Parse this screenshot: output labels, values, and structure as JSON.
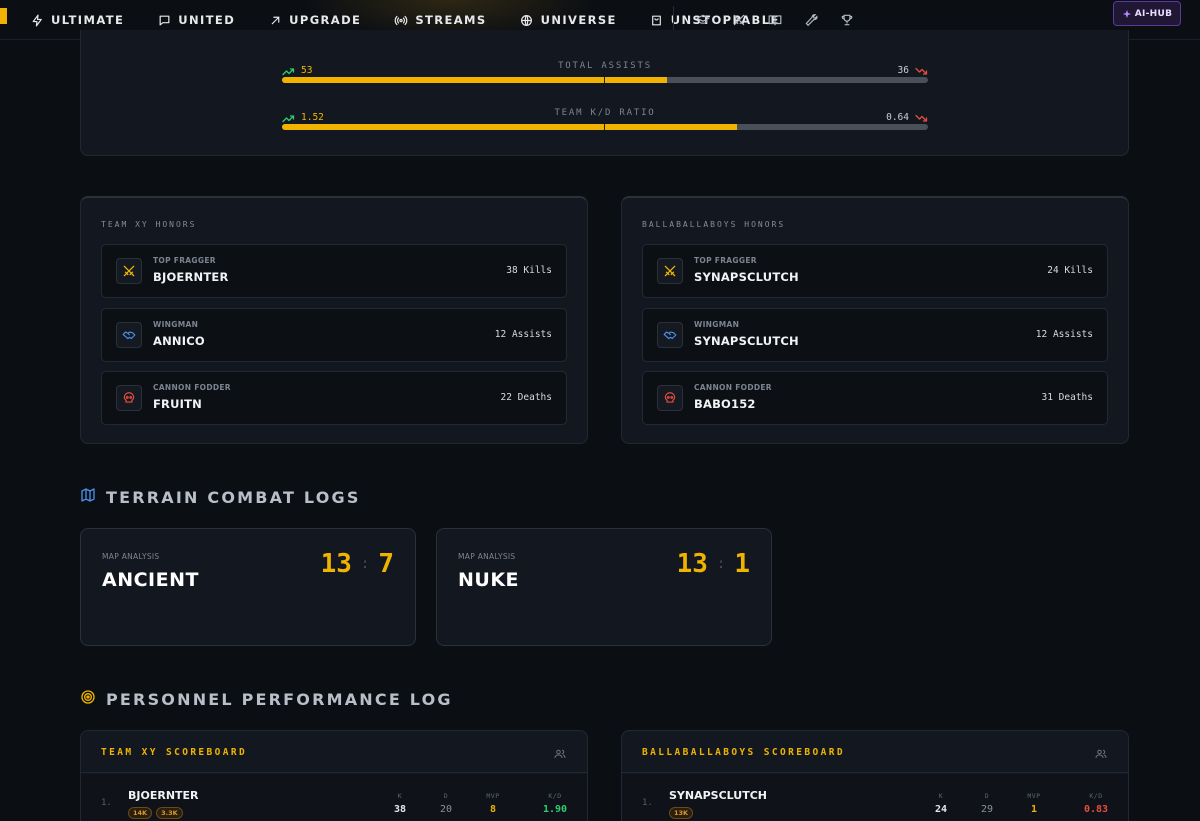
{
  "nav": {
    "items": [
      {
        "label": "ULTIMATE",
        "icon": "bolt-icon"
      },
      {
        "label": "UNITED",
        "icon": "chat-bubble-icon"
      },
      {
        "label": "UPGRADE",
        "icon": "arrow-up-right-icon"
      },
      {
        "label": "STREAMS",
        "icon": "broadcast-icon"
      },
      {
        "label": "UNIVERSE",
        "icon": "globe-icon"
      },
      {
        "label": "UNSTOPPABLE",
        "icon": "shopping-bag-icon"
      }
    ],
    "icon_buttons": [
      "graduation-cap-icon",
      "crossed-swords-icon",
      "book-open-icon",
      "wrench-icon",
      "trophy-icon"
    ],
    "ai_hub_label": "AI-HUB"
  },
  "comparison": [
    {
      "stat": "TOTAL ASSISTS",
      "left": "53",
      "right": "36",
      "left_share": 0.5955
    },
    {
      "stat": "TEAM K/D RATIO",
      "left": "1.52",
      "right": "0.64",
      "left_share": 0.7037
    }
  ],
  "honors": [
    {
      "title": "TEAM XY HONORS",
      "cards": [
        {
          "category": "TOP FRAGGER",
          "player": "BJOERNTER",
          "stat": "38 Kills",
          "icon": "swords-icon"
        },
        {
          "category": "WINGMAN",
          "player": "ANNICO",
          "stat": "12 Assists",
          "icon": "handshake-icon"
        },
        {
          "category": "CANNON FODDER",
          "player": "FRUITN",
          "stat": "22 Deaths",
          "icon": "skull-icon"
        }
      ]
    },
    {
      "title": "BALLABALLABOYS HONORS",
      "cards": [
        {
          "category": "TOP FRAGGER",
          "player": "SYNAPSCLUTCH",
          "stat": "24 Kills",
          "icon": "swords-icon"
        },
        {
          "category": "WINGMAN",
          "player": "SYNAPSCLUTCH",
          "stat": "12 Assists",
          "icon": "handshake-icon"
        },
        {
          "category": "CANNON FODDER",
          "player": "BABO152",
          "stat": "31 Deaths",
          "icon": "skull-icon"
        }
      ]
    }
  ],
  "terrain": {
    "title": "TERRAIN COMBAT LOGS",
    "maps": [
      {
        "caption": "MAP ANALYSIS",
        "name": "ANCIENT",
        "score_a": "13",
        "score_b": "7"
      },
      {
        "caption": "MAP ANALYSIS",
        "name": "NUKE",
        "score_a": "13",
        "score_b": "1"
      }
    ]
  },
  "performance": {
    "title": "PERSONNEL PERFORMANCE LOG",
    "boards": [
      {
        "title": "TEAM XY SCOREBOARD",
        "columns": [
          "K",
          "D",
          "MVP",
          "K/D"
        ],
        "rows": [
          {
            "rank": "1.",
            "player": "BJOERNTER",
            "badges": [
              "14K",
              "3.3K"
            ],
            "k": "38",
            "d": "20",
            "mvp": "8",
            "kd": "1.90"
          }
        ]
      },
      {
        "title": "BALLABALLABOYS SCOREBOARD",
        "columns": [
          "K",
          "D",
          "MVP",
          "K/D"
        ],
        "rows": [
          {
            "rank": "1.",
            "player": "SYNAPSCLUTCH",
            "badges": [
              "13K"
            ],
            "k": "24",
            "d": "29",
            "mvp": "1",
            "kd": "0.83"
          }
        ]
      }
    ]
  },
  "colors": {
    "accent": "#f0b400",
    "positive": "#2ecc71",
    "negative": "#e74c3c",
    "info": "#4a8fe7"
  }
}
